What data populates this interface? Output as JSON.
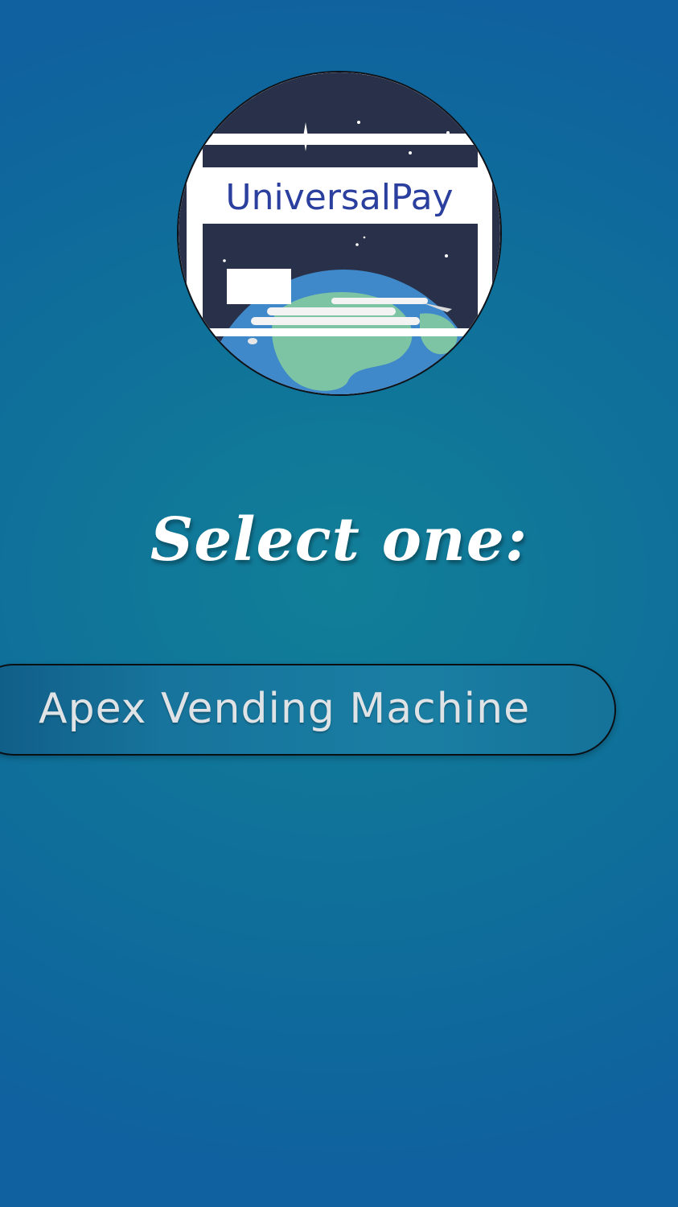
{
  "logo": {
    "text": "UniversalPay",
    "icon": "universalpay-logo"
  },
  "heading": {
    "text": "Select one:"
  },
  "options": [
    {
      "label": "Apex Vending Machine"
    }
  ],
  "colors": {
    "background": "#117f98",
    "heading": "#ffffff",
    "option_text": "#dfe3e6",
    "logo_text": "#2a3f9e"
  }
}
